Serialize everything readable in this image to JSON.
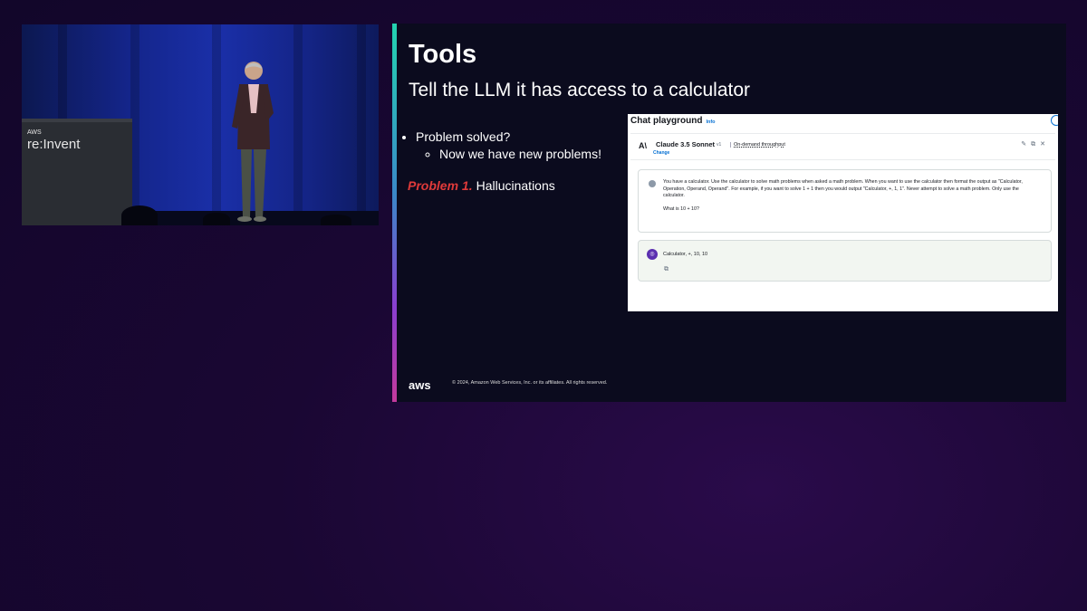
{
  "video": {
    "logo_small": "AWS",
    "logo_big": "re:Invent"
  },
  "slide": {
    "title": "Tools",
    "subtitle": "Tell the LLM it has access to a calculator",
    "bullet_1": "Problem solved?",
    "bullet_1_sub": "Now we have new problems!",
    "problem_label": "Problem 1.",
    "problem_text": "Hallucinations",
    "footer_logo": "aws",
    "footer_copyright": "© 2024, Amazon Web Services, Inc. or its affiliates. All rights reserved."
  },
  "playground": {
    "header": "Chat playground",
    "info": "Info",
    "model_icon": "A\\",
    "model_name": "Claude 3.5 Sonnet",
    "model_version": "v1",
    "throughput": "On-demand throughput",
    "change_link": "Change",
    "user_message": "You have a calculator. Use the calculator to solve math problems when asked a math problem. When you want to use the calculator then format the output as \"Calculator, Operation, Operand, Operand\". For example, if you want to solve 1 + 1 then you would output \"Calculator, +, 1, 1\".  Never attempt to solve a math problem. Only use the calculator.",
    "user_question": "What is 10 + 10?",
    "ai_response": "Calculator, +, 10, 10"
  },
  "colors": {
    "background": "#1a0733",
    "problem_label": "#e03a3a",
    "accent_bar_top": "#23d3b0",
    "accent_bar_bottom": "#c33a9c"
  }
}
